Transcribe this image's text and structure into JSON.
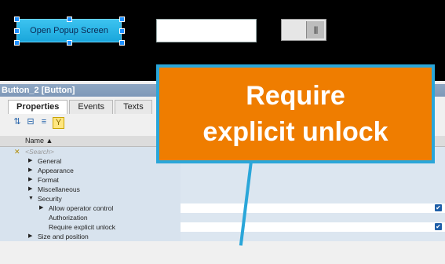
{
  "canvas": {
    "popup_button_label": "Open Popup Screen"
  },
  "inspector": {
    "title": "Button_2 [Button]",
    "tabs": [
      "Properties",
      "Events",
      "Texts"
    ],
    "column_name": "Name",
    "search_placeholder": "<Search>",
    "rows": [
      {
        "label": "General"
      },
      {
        "label": "Appearance"
      },
      {
        "label": "Format"
      },
      {
        "label": "Miscellaneous"
      },
      {
        "label": "Security"
      },
      {
        "label": "Allow operator control"
      },
      {
        "label": "Authorization"
      },
      {
        "label": "Require explicit unlock"
      },
      {
        "label": "Size and position"
      }
    ]
  },
  "callout": {
    "text": "Require\nexplicit unlock"
  },
  "colors": {
    "callout_bg": "#ef7d00",
    "callout_border": "#2aa6d9",
    "accent": "#1f5fa8"
  }
}
